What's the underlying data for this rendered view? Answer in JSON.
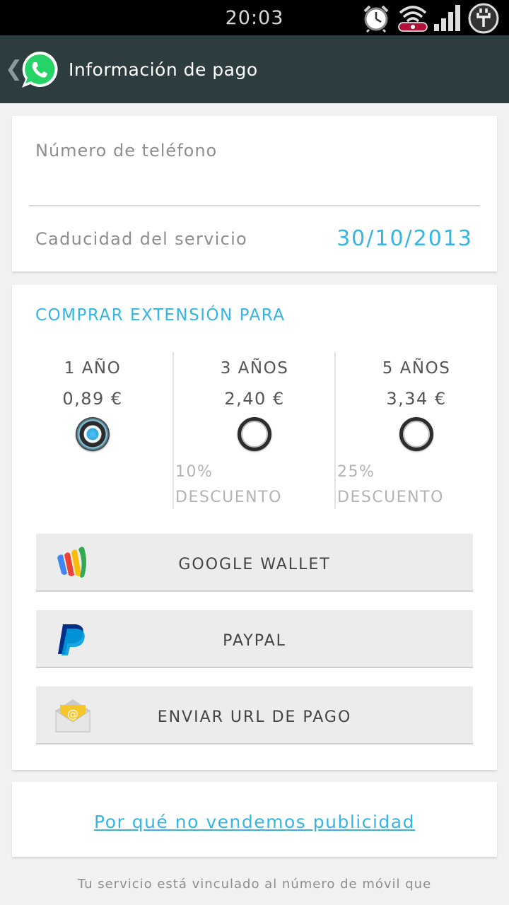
{
  "status_bar": {
    "time": "20:03",
    "icons": [
      "alarm-icon",
      "wifi-icon",
      "signal-icon",
      "battery-charging-icon"
    ]
  },
  "action_bar": {
    "title": "Información de pago",
    "back_icon": "chevron-left-icon",
    "app_icon": "whatsapp-logo"
  },
  "account": {
    "phone_label": "Número de teléfono",
    "expiry_label": "Caducidad del servicio",
    "expiry_value": "30/10/2013"
  },
  "extension": {
    "heading": "COMPRAR EXTENSIÓN PARA",
    "plans": [
      {
        "title": "1 AÑO",
        "price": "0,89 €",
        "discount": "",
        "selected": true
      },
      {
        "title": "3 AÑOS",
        "price": "2,40 €",
        "discount_pct": "10%",
        "discount_word": "DESCUENTO",
        "selected": false
      },
      {
        "title": "5 AÑOS",
        "price": "3,34 €",
        "discount_pct": "25%",
        "discount_word": "DESCUENTO",
        "selected": false
      }
    ]
  },
  "payment_methods": [
    {
      "label": "GOOGLE WALLET",
      "icon": "google-wallet-icon"
    },
    {
      "label": "PAYPAL",
      "icon": "paypal-icon"
    },
    {
      "label": "ENVIAR URL DE PAGO",
      "icon": "email-icon"
    }
  ],
  "ads_link": "Por qué no vendemos publicidad",
  "footer_text": "Tu servicio está vinculado al número de móvil que",
  "colors": {
    "accent": "#33b5e5",
    "action_bar": "#2d3c3f",
    "whatsapp_green": "#25d366"
  }
}
